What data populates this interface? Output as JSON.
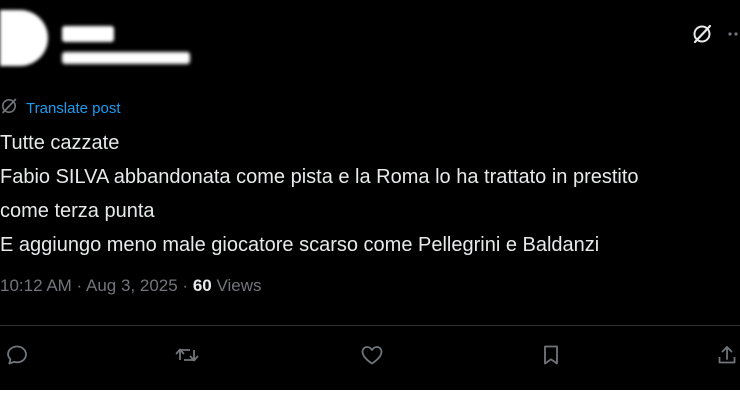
{
  "header": {
    "grok_icon": "grok-icon",
    "more_icon": "more-icon"
  },
  "translate": {
    "label": "Translate post",
    "icon": "translate-icon"
  },
  "post": {
    "lines": [
      "Tutte cazzate",
      "Fabio SILVA abbandonata come pista e la Roma lo ha trattato in prestito",
      "come terza punta",
      "E aggiungo meno male giocatore scarso come Pellegrini e Baldanzi"
    ]
  },
  "meta": {
    "time": "10:12 AM",
    "separator1": " · ",
    "date": "Aug 3, 2025",
    "separator2": " · ",
    "views_count": "60",
    "views_label": " Views"
  },
  "actions": {
    "reply": "reply-icon",
    "repost": "repost-icon",
    "like": "like-icon",
    "bookmark": "bookmark-icon",
    "share": "share-icon"
  },
  "colors": {
    "background": "#000000",
    "text": "#e7e9ea",
    "secondary": "#71767b",
    "accent": "#1d9bf0",
    "divider": "#2f3336"
  }
}
